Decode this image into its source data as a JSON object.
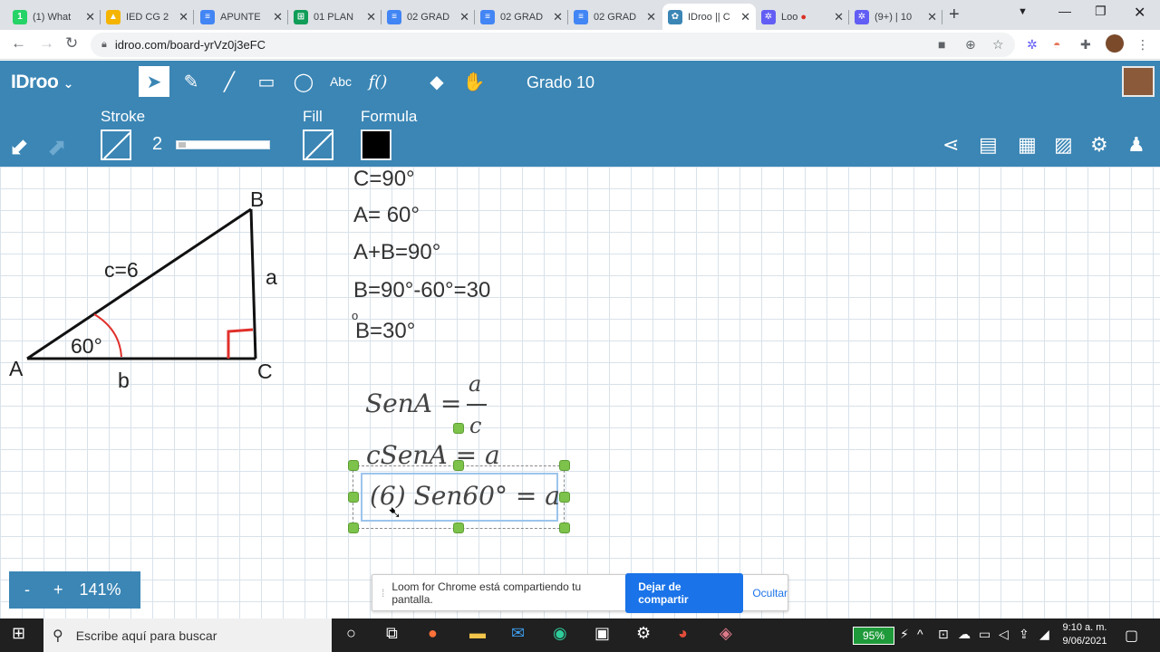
{
  "browser": {
    "tabs": [
      {
        "title": "(1) What",
        "fav": "whatsapp-icon",
        "color": "#25d366",
        "fav_text": "1"
      },
      {
        "title": "IED CG 2",
        "fav": "drive-icon",
        "color": "#f4b400",
        "fav_text": "▲"
      },
      {
        "title": "APUNTE",
        "fav": "docs-icon",
        "color": "#4285f4",
        "fav_text": "≡"
      },
      {
        "title": "01 PLAN",
        "fav": "sheets-icon",
        "color": "#0f9d58",
        "fav_text": "⊞"
      },
      {
        "title": "02 GRAD",
        "fav": "docs-icon",
        "color": "#4285f4",
        "fav_text": "≡"
      },
      {
        "title": "02 GRAD",
        "fav": "docs-icon",
        "color": "#4285f4",
        "fav_text": "≡"
      },
      {
        "title": "02 GRAD",
        "fav": "docs-icon",
        "color": "#4285f4",
        "fav_text": "≡"
      },
      {
        "title": "IDroo || C",
        "fav": "idroo-icon",
        "color": "#3b86b5",
        "fav_text": "✿"
      },
      {
        "title": "Loo",
        "fav": "loom-icon",
        "color": "#625df5",
        "fav_text": "✲"
      },
      {
        "title": "(9+) | 10",
        "fav": "loom-icon",
        "color": "#625df5",
        "fav_text": "✲"
      }
    ],
    "url": "idroo.com/board-yrVz0j3eFC"
  },
  "toolbar": {
    "logo": "IDroo",
    "board_name": "Grado 10",
    "stroke_label": "Stroke",
    "stroke_width": "2",
    "fill_label": "Fill",
    "formula_label": "Formula"
  },
  "board": {
    "triangle_labels": {
      "B": "B",
      "A": "A",
      "C": "C",
      "c": "c=6",
      "a": "a",
      "b": "b",
      "angle": "60°"
    },
    "equations": [
      "C=90°",
      "A= 60°",
      "A+B=90°",
      "B=90°-60°=30",
      "B=30°"
    ],
    "stray_mark": "o",
    "formulas": {
      "f1_left": "SenA =",
      "f1_num": "a",
      "f1_den": "c",
      "f2": "cSenA = a",
      "f3": "(6) Sen60° = a"
    }
  },
  "zoom": {
    "minus": "-",
    "plus": "+",
    "level": "141%"
  },
  "loom": {
    "message": "Loom for Chrome está compartiendo tu pantalla.",
    "stop_label": "Dejar de compartir",
    "hide_label": "Ocultar"
  },
  "taskbar": {
    "search_placeholder": "Escribe aquí para buscar",
    "battery": "95%",
    "time": "9:10 a. m.",
    "date": "9/06/2021"
  },
  "colors": {
    "accent": "#3b86b5",
    "handle": "#7dc24a",
    "loom_blue": "#1a73e8"
  }
}
